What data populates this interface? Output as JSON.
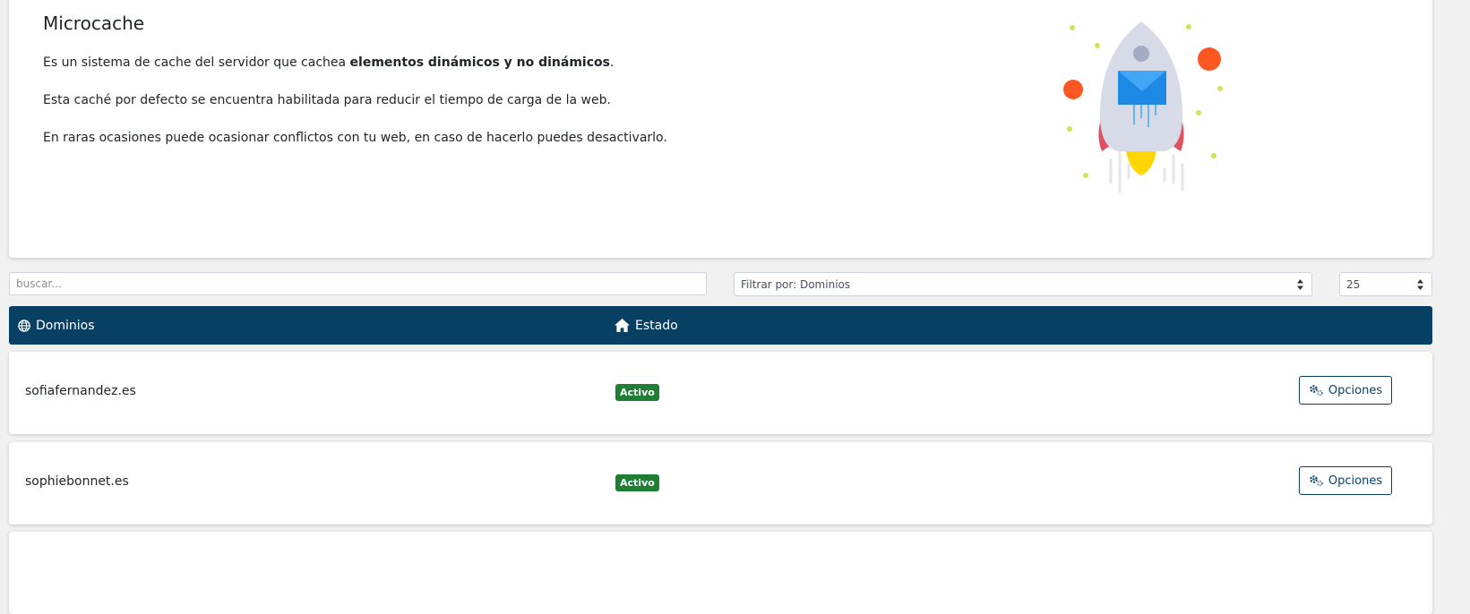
{
  "info": {
    "title": "Microcache",
    "line1_prefix": "Es un sistema de cache del servidor que cachea ",
    "line1_bold": "elementos dinámicos y no dinámicos",
    "line1_suffix": ".",
    "line2": "Esta caché por defecto se encuentra habilitada para reducir el tiempo de carga de la web.",
    "line3": "En raras ocasiones puede ocasionar conflictos con tu web, en caso de hacerlo puedes desactivarlo."
  },
  "filters": {
    "search_placeholder": "buscar...",
    "filter_value": "Filtrar por: Dominios",
    "count_value": "25"
  },
  "table": {
    "headers": [
      {
        "label": "Dominios",
        "icon": "globe-icon"
      },
      {
        "label": "Estado",
        "icon": "home-icon"
      }
    ],
    "rows": [
      {
        "domain": "sofiafernandez.es",
        "status": "Activo",
        "button": "Opciones"
      },
      {
        "domain": "sophiebonnet.es",
        "status": "Activo",
        "button": "Opciones"
      }
    ]
  },
  "colors": {
    "header_bg": "#084063",
    "badge_bg": "#1e7e34",
    "page_bg": "#f1f1f1"
  }
}
